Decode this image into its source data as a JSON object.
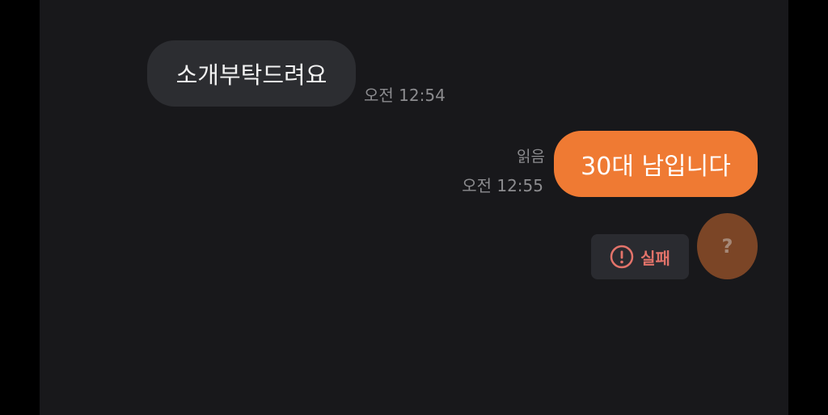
{
  "messages": {
    "incoming": {
      "text": "소개부탁드려요",
      "time": "오전 12:54"
    },
    "outgoing": {
      "text": "30대 남입니다",
      "read_status": "읽음",
      "time": "오전 12:55"
    }
  },
  "failure": {
    "icon": "alert-circle-icon",
    "label": "실패"
  },
  "avatar": {
    "glyph": "?"
  },
  "colors": {
    "background": "#18181b",
    "incoming_bubble": "#2c2d31",
    "outgoing_bubble": "#ef7a33",
    "failure_text": "#e3736a",
    "avatar": "#7b4526"
  }
}
